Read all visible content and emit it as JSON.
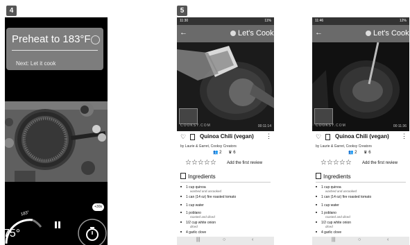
{
  "step4": {
    "badge": "4"
  },
  "step5": {
    "badge": "5"
  },
  "cook_mode": {
    "preheat_title": "Preheat to 183°F",
    "next_label": "Next: Let it cook",
    "dial_label": "183°",
    "temp_readout": "75°",
    "plus_badge": "+30s",
    "pause_icon": "pause-icon",
    "timer_icon": "stopwatch-icon"
  },
  "phones": [
    {
      "status_time": "11:30",
      "status_right": "11%",
      "app_title": "Let's Cook",
      "watermark": "COOKSY.COM",
      "video_time": "00:11:14",
      "recipe_title": "Quinoa Chili (vegan)",
      "author": "by Laurie & Garret, Cooksy Creators",
      "count_people": "2",
      "count_chef": "6",
      "review_link": "Add the first review",
      "ingredients_header": "Ingredients",
      "ingredients": [
        {
          "name": "1 cup quinoa",
          "note": "washed and uncooked"
        },
        {
          "name": "1 can (14 oz) fire roasted tomato",
          "note": ""
        },
        {
          "name": "1 cup water",
          "note": ""
        },
        {
          "name": "1 poblano",
          "note": "roasted and diced"
        },
        {
          "name": "1/2 cup white onion",
          "note": "diced"
        },
        {
          "name": "4 garlic clove",
          "note": ""
        }
      ]
    },
    {
      "status_time": "11:46",
      "status_right": "12%",
      "app_title": "Let's Cook",
      "watermark": "COOKSY.COM",
      "video_time": "00:11:36",
      "recipe_title": "Quinoa Chili (vegan)",
      "author": "by Laurie & Garret, Cooksy Creators",
      "count_people": "2",
      "count_chef": "6",
      "review_link": "Add the first review",
      "ingredients_header": "Ingredients",
      "ingredients": [
        {
          "name": "1 cup quinoa",
          "note": "washed and uncooked"
        },
        {
          "name": "1 can (14 oz) fire roasted tomato",
          "note": ""
        },
        {
          "name": "1 cup water",
          "note": ""
        },
        {
          "name": "1 poblano",
          "note": "roasted and diced"
        },
        {
          "name": "1/2 cup white onion",
          "note": "diced"
        },
        {
          "name": "4 garlic clove",
          "note": ""
        }
      ]
    }
  ],
  "nav": {
    "recents": "|||",
    "home": "○",
    "back": "‹"
  },
  "colors": {
    "appbar": "#6a6a6a",
    "card": "#7d7d7d"
  }
}
